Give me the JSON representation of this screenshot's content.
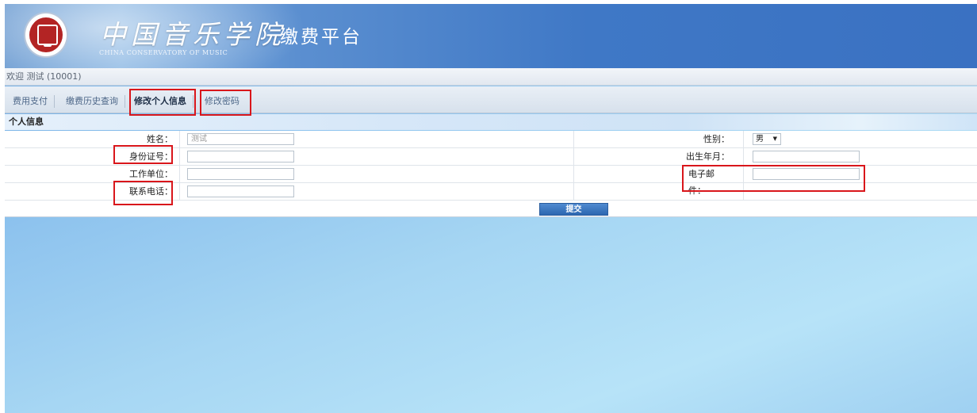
{
  "header": {
    "logo_cn": "中国音乐学院",
    "logo_en": "CHINA CONSERVATORY OF MUSIC",
    "platform_title": "缴费平台"
  },
  "welcome": "欢迎 测试 (10001)",
  "tabs": [
    {
      "label": "费用支付"
    },
    {
      "label": "缴费历史查询"
    },
    {
      "label": "修改个人信息",
      "active": true
    },
    {
      "label": "修改密码"
    }
  ],
  "section_title": "个人信息",
  "form": {
    "name_label": "姓名：",
    "name_placeholder": "测试",
    "id_label": "身份证号：",
    "work_label": "工作单位：",
    "phone_label": "联系电话：",
    "gender_label": "性别：",
    "gender_value": "男",
    "birth_label": "出生年月：",
    "email_label": "电子邮件："
  },
  "submit_label": "提交",
  "colors": {
    "header_blue": "#3f78c6",
    "highlight_red": "#d9161b",
    "button_blue": "#2d67b0"
  }
}
